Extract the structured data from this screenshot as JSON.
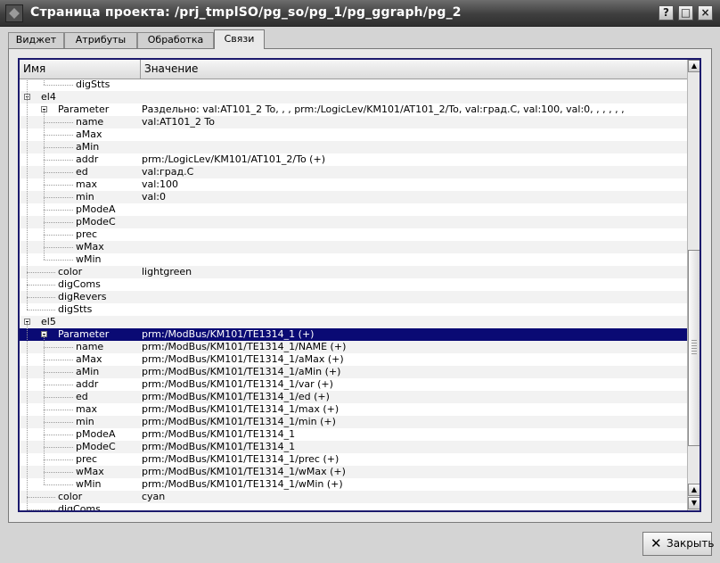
{
  "window": {
    "title": "Страница проекта: /prj_tmplSO/pg_so/pg_1/pg_ggraph/pg_2",
    "buttons": [
      "?",
      "□",
      "×"
    ]
  },
  "tabs": [
    {
      "label": "Виджет",
      "active": false
    },
    {
      "label": "Атрибуты",
      "active": false
    },
    {
      "label": "Обработка",
      "active": false
    },
    {
      "label": "Связи",
      "active": true
    }
  ],
  "tree": {
    "columns": [
      "Имя",
      "Значение"
    ],
    "rows": [
      {
        "name": "digStts",
        "value": "",
        "level": 2
      },
      {
        "name": "el4",
        "value": "",
        "level": 0
      },
      {
        "name": "Parameter",
        "value": "Раздельно: val:AT101_2 To, , , prm:/LogicLev/KM101/AT101_2/To, val:град.С, val:100, val:0, , , , , ,",
        "level": 1
      },
      {
        "name": "name",
        "value": "val:AT101_2 To",
        "level": 2
      },
      {
        "name": "aMax",
        "value": "",
        "level": 2
      },
      {
        "name": "aMin",
        "value": "",
        "level": 2
      },
      {
        "name": "addr",
        "value": "prm:/LogicLev/KM101/AT101_2/To (+)",
        "level": 2
      },
      {
        "name": "ed",
        "value": "val:град.С",
        "level": 2
      },
      {
        "name": "max",
        "value": "val:100",
        "level": 2
      },
      {
        "name": "min",
        "value": "val:0",
        "level": 2
      },
      {
        "name": "pModeA",
        "value": "",
        "level": 2
      },
      {
        "name": "pModeC",
        "value": "",
        "level": 2
      },
      {
        "name": "prec",
        "value": "",
        "level": 2
      },
      {
        "name": "wMax",
        "value": "",
        "level": 2
      },
      {
        "name": "wMin",
        "value": "",
        "level": 2
      },
      {
        "name": "color",
        "value": "lightgreen",
        "level": 1
      },
      {
        "name": "digComs",
        "value": "",
        "level": 1
      },
      {
        "name": "digRevers",
        "value": "",
        "level": 1
      },
      {
        "name": "digStts",
        "value": "",
        "level": 1
      },
      {
        "name": "el5",
        "value": "",
        "level": 0
      },
      {
        "name": "Parameter",
        "value": "prm:/ModBus/KM101/TE1314_1 (+)",
        "level": 1,
        "selected": true
      },
      {
        "name": "name",
        "value": "prm:/ModBus/KM101/TE1314_1/NAME (+)",
        "level": 2
      },
      {
        "name": "aMax",
        "value": "prm:/ModBus/KM101/TE1314_1/aMax (+)",
        "level": 2
      },
      {
        "name": "aMin",
        "value": "prm:/ModBus/KM101/TE1314_1/aMin (+)",
        "level": 2
      },
      {
        "name": "addr",
        "value": "prm:/ModBus/KM101/TE1314_1/var (+)",
        "level": 2
      },
      {
        "name": "ed",
        "value": "prm:/ModBus/KM101/TE1314_1/ed (+)",
        "level": 2
      },
      {
        "name": "max",
        "value": "prm:/ModBus/KM101/TE1314_1/max (+)",
        "level": 2
      },
      {
        "name": "min",
        "value": "prm:/ModBus/KM101/TE1314_1/min (+)",
        "level": 2
      },
      {
        "name": "pModeA",
        "value": "prm:/ModBus/KM101/TE1314_1",
        "level": 2
      },
      {
        "name": "pModeC",
        "value": "prm:/ModBus/KM101/TE1314_1",
        "level": 2
      },
      {
        "name": "prec",
        "value": "prm:/ModBus/KM101/TE1314_1/prec (+)",
        "level": 2
      },
      {
        "name": "wMax",
        "value": "prm:/ModBus/KM101/TE1314_1/wMax (+)",
        "level": 2
      },
      {
        "name": "wMin",
        "value": "prm:/ModBus/KM101/TE1314_1/wMin (+)",
        "level": 2
      },
      {
        "name": "color",
        "value": "cyan",
        "level": 1
      },
      {
        "name": "digComs",
        "value": "",
        "level": 1
      }
    ]
  },
  "footer": {
    "close_label": "Закрыть",
    "close_icon": "close-x-icon"
  }
}
